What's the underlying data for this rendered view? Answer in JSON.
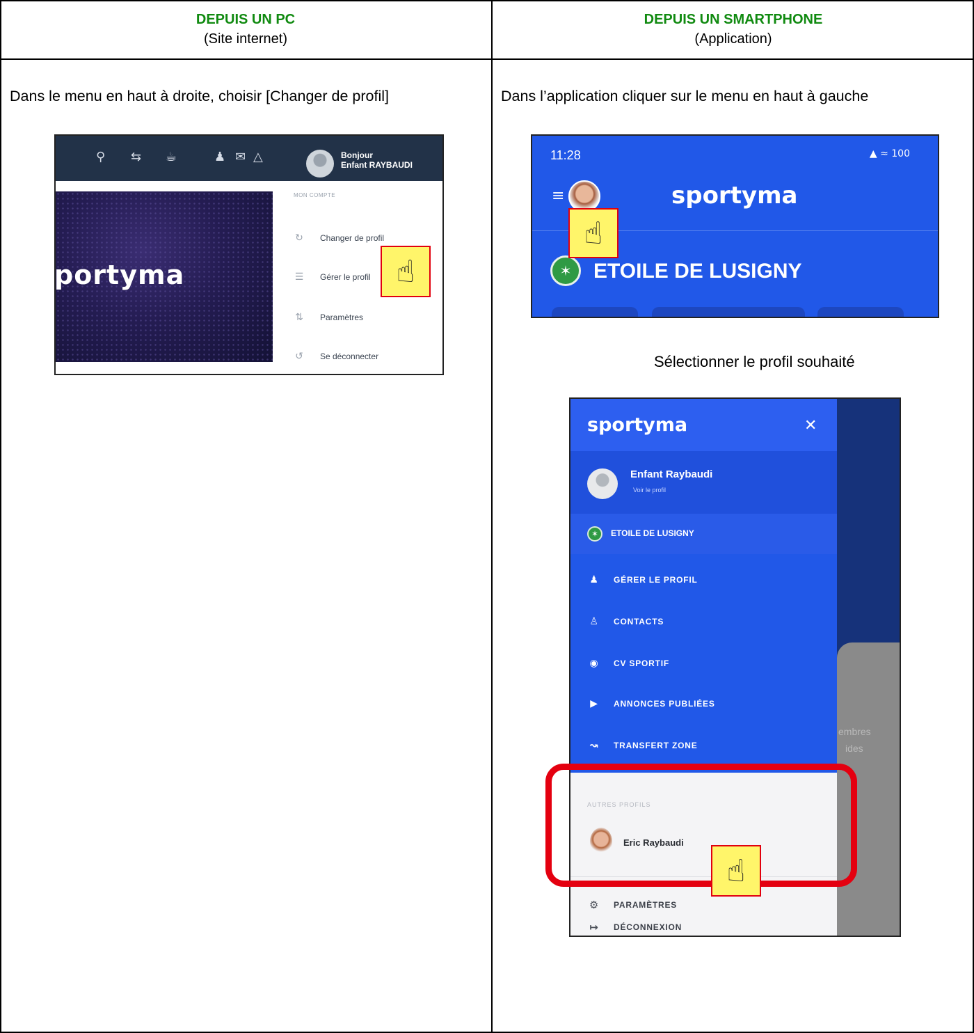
{
  "table": {
    "col_left": {
      "title": "DEPUIS UN PC",
      "subtitle": "(Site internet)"
    },
    "col_right": {
      "title": "DEPUIS UN SMARTPHONE",
      "subtitle": "(Application)"
    }
  },
  "instructions": {
    "pc": "Dans le menu en haut à droite, choisir [Changer de profil]",
    "phone_step1": "Dans l’application cliquer sur le menu en haut à gauche",
    "phone_step2": "Sélectionner le profil souhaité"
  },
  "pc_screenshot": {
    "greeting": "Bonjour",
    "user": "Enfant RAYBAUDI",
    "logo": "portyma",
    "menu_header": "MON COMPTE",
    "menu_items": [
      {
        "icon": "switch-icon",
        "label": "Changer de profil"
      },
      {
        "icon": "list-icon",
        "label": "Gérer le profil"
      },
      {
        "icon": "sliders-icon",
        "label": "Paramètres"
      },
      {
        "icon": "logout-icon",
        "label": "Se déconnecter"
      }
    ]
  },
  "phone_header": {
    "time": "11:28",
    "battery": "100",
    "brand": "sportyma",
    "club": "ETOILE DE LUSIGNY"
  },
  "phone_drawer": {
    "brand": "sportyma",
    "profile_name": "Enfant Raybaudi",
    "profile_link": "Voir le profil",
    "club": "ETOILE DE LUSIGNY",
    "menu_items": [
      {
        "icon": "manage-profile-icon",
        "label": "GÉRER LE PROFIL"
      },
      {
        "icon": "contacts-icon",
        "label": "CONTACTS"
      },
      {
        "icon": "play-icon",
        "label": "CV SPORTIF"
      },
      {
        "icon": "megaphone-icon",
        "label": "ANNONCES PUBLIÉES"
      },
      {
        "icon": "transfer-icon",
        "label": "TRANSFERT ZONE"
      }
    ],
    "other_profiles_header": "AUTRES PROFILS",
    "other_profile": "Eric Raybaudi",
    "bottom_items": [
      {
        "icon": "gear-icon",
        "label": "PARAMÈTRES"
      },
      {
        "icon": "logout-icon",
        "label": "DÉCONNEXION"
      }
    ],
    "background_text": [
      "embres",
      "ides"
    ]
  },
  "colors": {
    "heading_green": "#108a10",
    "sportyma_blue": "#2158e8",
    "highlight_red": "#e40010",
    "cursor_yellow": "#fff56a"
  }
}
